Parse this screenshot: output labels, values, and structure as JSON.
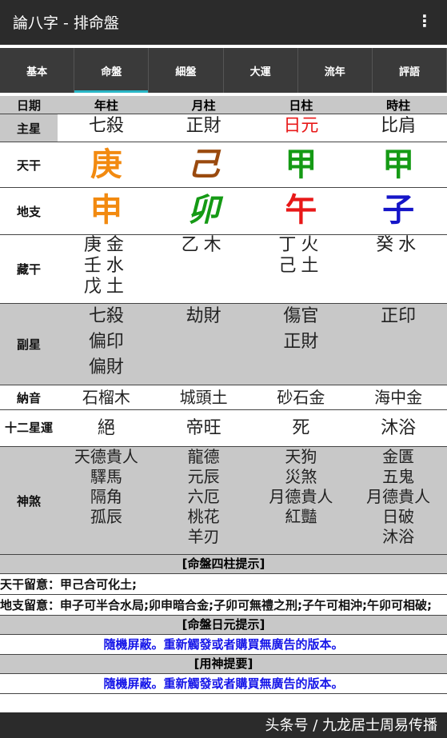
{
  "app": {
    "title": "論八字 - 排命盤",
    "menu_glyph": "⋮"
  },
  "tabs": [
    "基本",
    "命盤",
    "細盤",
    "大運",
    "流年",
    "評語"
  ],
  "header": {
    "label": "日期",
    "cols": [
      "年柱",
      "月柱",
      "日柱",
      "時柱"
    ]
  },
  "main_star": {
    "label": "主星",
    "cols": [
      "七殺",
      "正財",
      "日元",
      "比肩"
    ],
    "colors": [
      "#222222",
      "#222222",
      "#e81818",
      "#222222"
    ]
  },
  "tiangan": {
    "label": "天干",
    "cols": [
      "庚",
      "己",
      "甲",
      "甲"
    ],
    "colors": [
      "#f28a10",
      "#9a4a0e",
      "#159a15",
      "#159a15"
    ]
  },
  "dizhi": {
    "label": "地支",
    "cols": [
      "申",
      "卯",
      "午",
      "子"
    ],
    "colors": [
      "#f28a10",
      "#159a15",
      "#e81818",
      "#1515c8"
    ]
  },
  "canggan": {
    "label": "藏干",
    "cols": [
      [
        "庚金",
        "壬水",
        "戊土"
      ],
      [
        "乙木"
      ],
      [
        "丁火",
        "己土"
      ],
      [
        "癸水"
      ]
    ]
  },
  "fuxing": {
    "label": "副星",
    "cols": [
      [
        "七殺",
        "偏印",
        "偏財"
      ],
      [
        "劫財"
      ],
      [
        "傷官",
        "正財"
      ],
      [
        "正印"
      ]
    ]
  },
  "nayin": {
    "label": "納音",
    "cols": [
      "石榴木",
      "城頭土",
      "砂石金",
      "海中金"
    ]
  },
  "xingyun": {
    "label": "十二星運",
    "cols": [
      "絕",
      "帝旺",
      "死",
      "沐浴"
    ]
  },
  "shensha": {
    "label": "神煞",
    "cols": [
      [
        "天德貴人",
        "驛馬",
        "隔角",
        "孤辰"
      ],
      [
        "龍德",
        "元辰",
        "六厄",
        "桃花",
        "羊刃"
      ],
      [
        "天狗",
        "災煞",
        "月德貴人",
        "紅豔"
      ],
      [
        "金匱",
        "五鬼",
        "月德貴人",
        "日破",
        "沐浴"
      ]
    ]
  },
  "sections": {
    "pillars_tip": "[命盤四柱提示]",
    "tiangan_note_key": "天干留意：",
    "tiangan_note": "甲己合可化土;",
    "dizhi_note_key": "地支留意：",
    "dizhi_note": "申子可半合水局;卯申暗合金;子卯可無禮之刑;子午可相沖;午卯可相破;",
    "dayuan_tip": "[命盤日元提示]",
    "hidden1": "隨機屏蔽。重新觸發或者購買無廣告的版本。",
    "yongshen_tip": "[用神提要]",
    "hidden2": "隨機屏蔽。重新觸發或者購買無廣告的版本。"
  },
  "watermark": "头条号 / 九龙居士周易传播"
}
